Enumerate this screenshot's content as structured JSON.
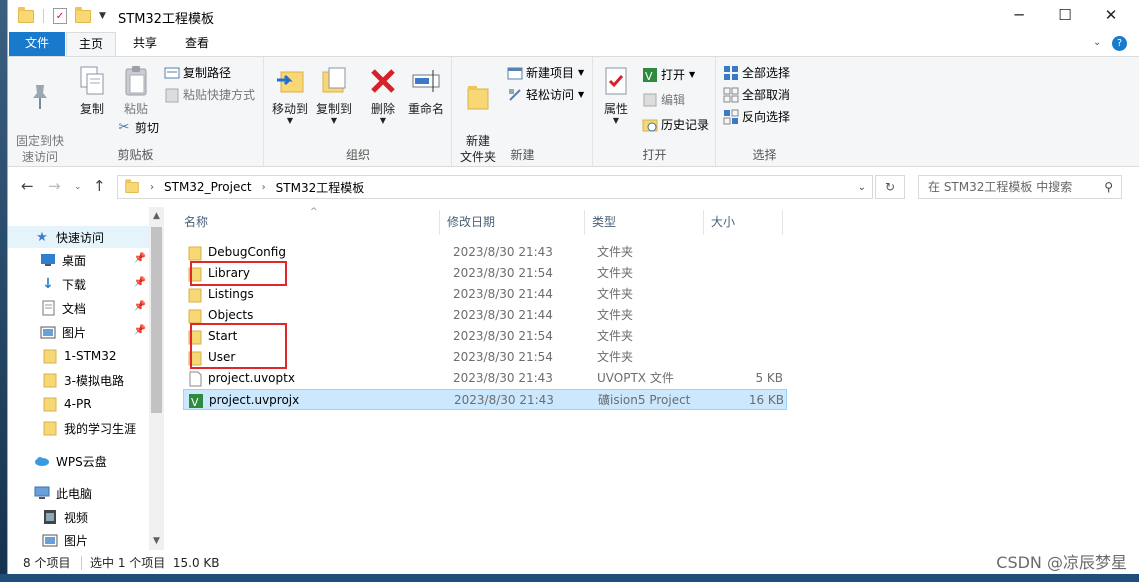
{
  "window": {
    "title": "STM32工程模板",
    "controls": {
      "minimize": "─",
      "maximize": "☐",
      "close": "✕"
    }
  },
  "ribbon_tabs": [
    "文件",
    "主页",
    "共享",
    "查看"
  ],
  "ribbon": {
    "clipboard": {
      "label": "剪贴板",
      "pin_quick": "固定到快\n速访问",
      "copy": "复制",
      "paste": "粘贴",
      "copy_path": "复制路径",
      "paste_shortcut": "粘贴快捷方式",
      "cut": "剪切"
    },
    "organize": {
      "label": "组织",
      "move_to": "移动到",
      "copy_to": "复制到",
      "delete": "删除",
      "rename": "重命名"
    },
    "new": {
      "label": "新建",
      "new_folder": "新建\n文件夹",
      "new_item": "新建项目",
      "easy_access": "轻松访问"
    },
    "open": {
      "label": "打开",
      "properties": "属性",
      "open": "打开",
      "edit": "编辑",
      "history": "历史记录"
    },
    "select": {
      "label": "选择",
      "select_all": "全部选择",
      "select_none": "全部取消",
      "invert": "反向选择"
    }
  },
  "address": {
    "crumbs": [
      "STM32_Project",
      "STM32工程模板"
    ],
    "search_placeholder": "在 STM32工程模板 中搜索"
  },
  "nav": {
    "quick_access": "快速访问",
    "items": [
      "桌面",
      "下载",
      "文档",
      "图片",
      "1-STM32",
      "3-模拟电路",
      "4-PR",
      "我的学习生涯"
    ],
    "wps": "WPS云盘",
    "this_pc": "此电脑",
    "pc_items": [
      "视频",
      "图片"
    ]
  },
  "columns": {
    "name": "名称",
    "date": "修改日期",
    "type": "类型",
    "size": "大小"
  },
  "files": [
    {
      "name": "DebugConfig",
      "date": "2023/8/30 21:43",
      "type": "文件夹",
      "size": "",
      "kind": "folder"
    },
    {
      "name": "Library",
      "date": "2023/8/30 21:54",
      "type": "文件夹",
      "size": "",
      "kind": "folder"
    },
    {
      "name": "Listings",
      "date": "2023/8/30 21:44",
      "type": "文件夹",
      "size": "",
      "kind": "folder"
    },
    {
      "name": "Objects",
      "date": "2023/8/30 21:44",
      "type": "文件夹",
      "size": "",
      "kind": "folder"
    },
    {
      "name": "Start",
      "date": "2023/8/30 21:54",
      "type": "文件夹",
      "size": "",
      "kind": "folder"
    },
    {
      "name": "User",
      "date": "2023/8/30 21:54",
      "type": "文件夹",
      "size": "",
      "kind": "folder"
    },
    {
      "name": "project.uvoptx",
      "date": "2023/8/30 21:43",
      "type": "UVOPTX 文件",
      "size": "5 KB",
      "kind": "file"
    },
    {
      "name": "project.uvprojx",
      "date": "2023/8/30 21:43",
      "type": "礦ision5 Project",
      "size": "16 KB",
      "kind": "project",
      "selected": true
    }
  ],
  "status": {
    "count": "8 个项目",
    "selected": "选中 1 个项目  15.0 KB"
  },
  "watermark": "CSDN @凉辰梦星",
  "colors": {
    "accent": "#1979ca",
    "selection": "#cce8ff",
    "highlight_box": "#e0272b",
    "folder": "#f8d775"
  }
}
